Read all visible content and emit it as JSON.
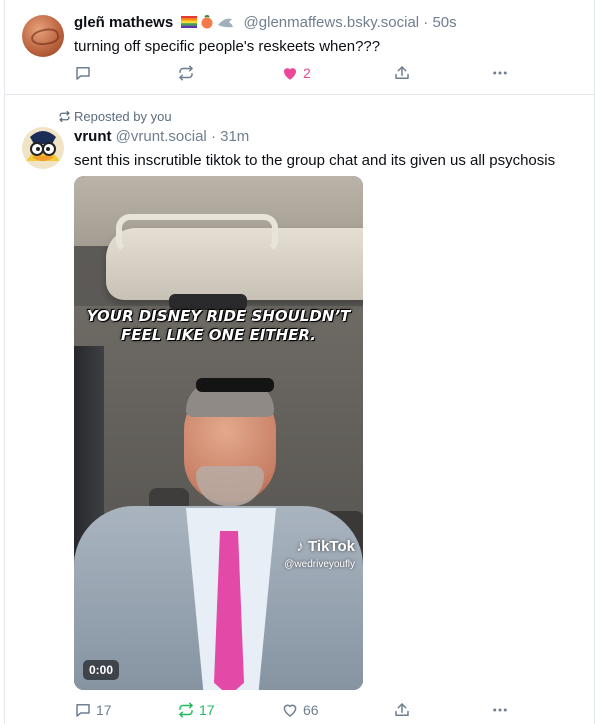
{
  "posts": [
    {
      "author_name": "gleñ mathews",
      "handle": "@glenmaffews.bsky.social",
      "time": "· 50s",
      "text": "turning off specific people's reskeets when???",
      "actions": {
        "reply_count": "",
        "repost_count": "",
        "like_count": "2"
      }
    },
    {
      "repost_label": "Reposted by you",
      "author_name": "vrunt",
      "handle": "@vrunt.social",
      "time": "· 31m",
      "text": "sent this inscrutible tiktok to the group chat and its given us all psychosis",
      "video": {
        "caption_line1": "YOUR DISNEY RIDE SHOULDN’T",
        "caption_line2": "FEEL LIKE ONE EITHER.",
        "watermark_logo": "TikTok",
        "watermark_user": "@wedriveyoufly",
        "timestamp": "0:00"
      },
      "actions": {
        "reply_count": "17",
        "repost_count": "17",
        "like_count": "66"
      }
    }
  ],
  "colors": {
    "like_active": "#ec4899",
    "repost_active": "#20bc5a",
    "muted": "#6f7f8f",
    "divider": "#e4e8ec"
  }
}
